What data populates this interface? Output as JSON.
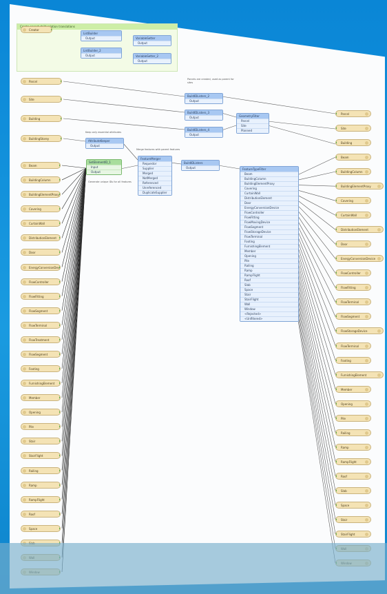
{
  "bookmark": {
    "title": "Create parent child relation translations"
  },
  "feeders_top": [
    {
      "label": "Parcel"
    },
    {
      "label": "Site"
    },
    {
      "label": "Building"
    },
    {
      "label": "BuildingStorey"
    }
  ],
  "feeders_left": [
    {
      "label": "Beam"
    },
    {
      "label": "BuildingColumn"
    },
    {
      "label": "BuildingElementProxy"
    },
    {
      "label": "Covering"
    },
    {
      "label": "CurtainWall"
    },
    {
      "label": "DistributionElement"
    },
    {
      "label": "Door"
    },
    {
      "label": "EnergyConversionDevice"
    },
    {
      "label": "FlowController"
    },
    {
      "label": "FlowFitting"
    },
    {
      "label": "FlowSegment"
    },
    {
      "label": "FlowTerminal"
    },
    {
      "label": "FlowTreatment"
    },
    {
      "label": "FlowSegment"
    },
    {
      "label": "Footing"
    },
    {
      "label": "FurnishingElement"
    },
    {
      "label": "Member"
    },
    {
      "label": "Opening"
    },
    {
      "label": "Pile"
    },
    {
      "label": "Stair"
    },
    {
      "label": "StairFlight"
    },
    {
      "label": "Railing"
    },
    {
      "label": "Ramp"
    },
    {
      "label": "RampFlight"
    },
    {
      "label": "Roof"
    },
    {
      "label": "Space"
    },
    {
      "label": "Slab"
    },
    {
      "label": "Wall"
    },
    {
      "label": "Window"
    }
  ],
  "writers_right": [
    {
      "label": "Parcel"
    },
    {
      "label": "Site"
    },
    {
      "label": "Building"
    },
    {
      "label": "Beam"
    },
    {
      "label": "BuildingColumn"
    },
    {
      "label": "BuildingElementProxy"
    },
    {
      "label": "Covering"
    },
    {
      "label": "CurtainWall"
    },
    {
      "label": "DistributionElement"
    },
    {
      "label": "Door"
    },
    {
      "label": "EnergyConversionDevice"
    },
    {
      "label": "FlowController"
    },
    {
      "label": "FlowFitting"
    },
    {
      "label": "FlowTerminal"
    },
    {
      "label": "FlowSegment"
    },
    {
      "label": "FlowStorageDevice"
    },
    {
      "label": "FlowTerminal"
    },
    {
      "label": "Footing"
    },
    {
      "label": "FurnishingElement"
    },
    {
      "label": "Member"
    },
    {
      "label": "Opening"
    },
    {
      "label": "Pile"
    },
    {
      "label": "Railing"
    },
    {
      "label": "Ramp"
    },
    {
      "label": "RampFlight"
    },
    {
      "label": "Roof"
    },
    {
      "label": "Slab"
    },
    {
      "label": "Space"
    },
    {
      "label": "Stair"
    },
    {
      "label": "StairFlight"
    },
    {
      "label": "Wall"
    },
    {
      "label": "Window"
    }
  ],
  "top_transformers": {
    "creator": {
      "label": "Creator"
    },
    "sampler_1": {
      "title": "ListBuilder",
      "port": "Output"
    },
    "sampler_2": {
      "title": "ListBuilder_2",
      "port": "Output"
    },
    "var_1": {
      "title": "VariableSetter",
      "port": "Output"
    },
    "var_2": {
      "title": "VariableSetter_2",
      "port": "Output"
    }
  },
  "middle": {
    "note_1": "Parcels are created, used as parent for sites",
    "joiner_2": {
      "title": "BuildIDListers_2",
      "port": "Output"
    },
    "joiner_3": {
      "title": "BuildIDListers_3",
      "port": "Output"
    },
    "joiner_4": {
      "title": "BuildIDListers_4",
      "port": "Output"
    },
    "geom_filter": {
      "title": "GeometryFilter",
      "ports": [
        "Parcel",
        "Site",
        "Planned"
      ]
    },
    "attr_keeper": {
      "title": "AttributeKeeper",
      "port": "Output"
    },
    "attr_note": "Keep only essential attributes",
    "feature_merger": {
      "title": "FeatureMerger",
      "ports": [
        "Requestor",
        "Supplier",
        "Merged",
        "NotMerged",
        "Referenced",
        "Unreferenced",
        "DuplicateSupplier"
      ]
    },
    "merger_note": "Merge features with parent features",
    "setelement": {
      "title": "SetElementID_1",
      "ports": [
        "Input",
        "Output"
      ]
    },
    "set_note": "Generate unique IDs for all features",
    "joiner_5": {
      "title": "BuildIDListers",
      "port": "Output"
    },
    "type_filter": {
      "title": "FeatureTypeFilter",
      "ports": [
        "Beam",
        "BuildingColumn",
        "BuildingElementProxy",
        "Covering",
        "CurtainWall",
        "DistributionElement",
        "Door",
        "EnergyConversionDevice",
        "FlowController",
        "FlowFitting",
        "FlowMovingDevice",
        "FlowSegment",
        "FlowStorageDevice",
        "FlowTerminal",
        "Footing",
        "FurnishingElement",
        "Member",
        "Opening",
        "Pile",
        "Railing",
        "Ramp",
        "RampFlight",
        "Roof",
        "Slab",
        "Space",
        "Stair",
        "StairFlight",
        "Wall",
        "Window",
        "<Rejected>",
        "<Unfiltered>"
      ]
    }
  }
}
